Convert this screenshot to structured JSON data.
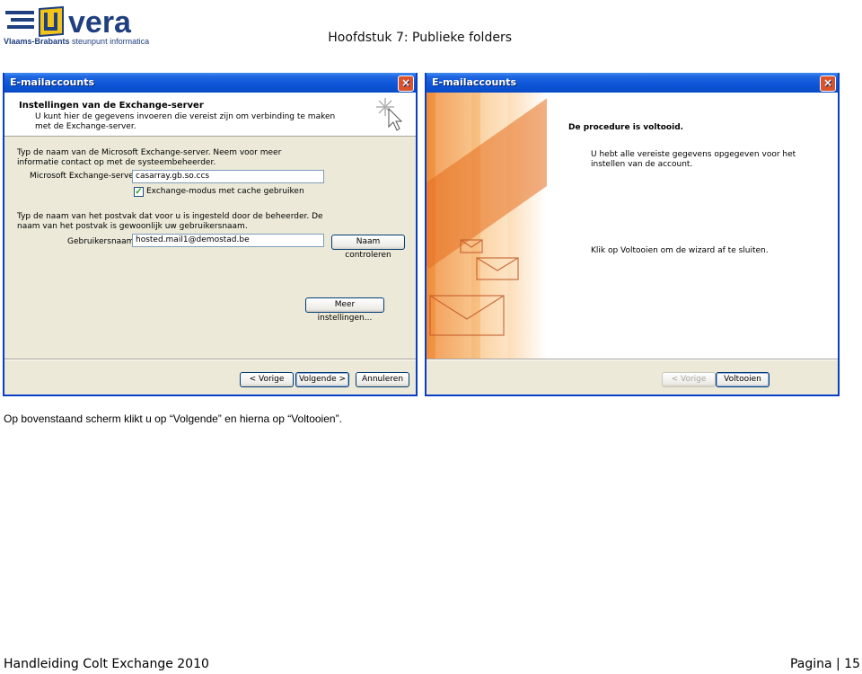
{
  "header": {
    "logo_text": "vera",
    "logo_sub_bold": "Vlaams-Brabants",
    "logo_sub_rest": " steunpunt informatica",
    "chapter": "Hoofdstuk 7: Publieke folders"
  },
  "left_window": {
    "title": "E-mailaccounts",
    "close": "×",
    "heading": "Instellingen van de Exchange-server",
    "heading_desc": "U kunt hier de gegevens invoeren die vereist zijn om verbinding te maken met de Exchange-server.",
    "server_intro": "Typ de naam van de Microsoft Exchange-server. Neem voor meer informatie contact op met de systeembeheerder.",
    "server_label": "Microsoft Exchange-server:",
    "server_value": "casarray.gb.so.ccs",
    "cache_check": "✓",
    "cache_label": "Exchange-modus met cache gebruiken",
    "mailbox_intro": "Typ de naam van het postvak dat voor u is ingesteld door de beheerder. De naam van het postvak is gewoonlijk uw gebruikersnaam.",
    "user_label": "Gebruikersnaam:",
    "user_value": "hosted.mail1@demostad.be",
    "check_name_btn": "Naam controleren",
    "more_settings_btn": "Meer instellingen...",
    "back_btn": "< Vorige",
    "next_btn": "Volgende >",
    "cancel_btn": "Annuleren"
  },
  "right_window": {
    "title": "E-mailaccounts",
    "close": "×",
    "done_heading": "De procedure is voltooid.",
    "done_text": "U hebt alle vereiste gegevens opgegeven voor het instellen van de account.",
    "finish_hint": "Klik op Voltooien om de wizard af te sluiten.",
    "back_btn": "< Vorige",
    "finish_btn": "Voltooien"
  },
  "caption": "Op bovenstaand scherm klikt u op “Volgende” en hierna op “Voltooien”.",
  "footer": {
    "left": "Handleiding Colt Exchange 2010",
    "right": "Pagina | 15"
  }
}
